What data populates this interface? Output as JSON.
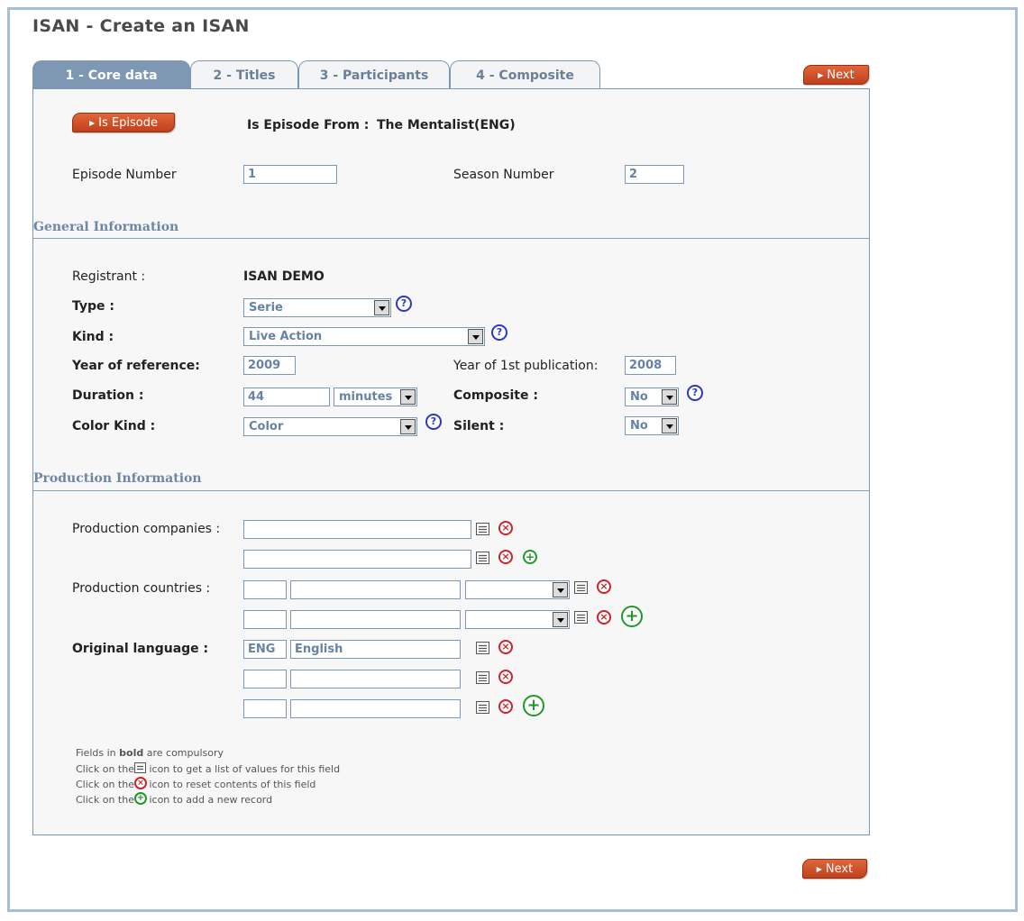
{
  "page": {
    "title": "ISAN - Create an ISAN"
  },
  "tabs": [
    {
      "label": "1 - Core data",
      "active": true
    },
    {
      "label": "2 - Titles",
      "active": false
    },
    {
      "label": "3 - Participants",
      "active": false
    },
    {
      "label": "4 - Composite",
      "active": false
    }
  ],
  "buttons": {
    "next": "Next",
    "is_episode": "Is Episode"
  },
  "episode": {
    "from_label": "Is Episode From :",
    "from_value": "The Mentalist(ENG)",
    "episode_number_label": "Episode Number",
    "episode_number": "1",
    "season_number_label": "Season Number",
    "season_number": "2"
  },
  "general": {
    "heading": "General Information",
    "registrant_label": "Registrant :",
    "registrant_value": "ISAN DEMO",
    "type_label": "Type :",
    "type_value": "Serie",
    "kind_label": "Kind :",
    "kind_value": "Live Action",
    "year_ref_label": "Year of reference:",
    "year_ref_value": "2009",
    "year_pub_label": "Year of 1st publication:",
    "year_pub_value": "2008",
    "duration_label": "Duration :",
    "duration_value": "44",
    "duration_unit": "minutes",
    "composite_label": "Composite :",
    "composite_value": "No",
    "color_label": "Color Kind :",
    "color_value": "Color",
    "silent_label": "Silent :",
    "silent_value": "No"
  },
  "production": {
    "heading": "Production Information",
    "companies_label": "Production companies :",
    "countries_label": "Production countries :",
    "language_label": "Original language :",
    "language_code": "ENG",
    "language_name": "English"
  },
  "legend": {
    "line1_pre": "Fields in ",
    "line1_bold": "bold",
    "line1_post": " are compulsory",
    "line2_pre": "Click on the",
    "line2_post": " icon to get a list of values for this field",
    "line3_pre": "Click on the",
    "line3_post": " icon to reset contents of this field",
    "line4_pre": "Click on the",
    "line4_post": " icon to add a new record"
  },
  "icons": {
    "help": "?",
    "delete": "×",
    "add": "+"
  },
  "colors": {
    "accent": "#7e97b2",
    "button": "#c9481f",
    "label_blue": "#6782a3"
  }
}
